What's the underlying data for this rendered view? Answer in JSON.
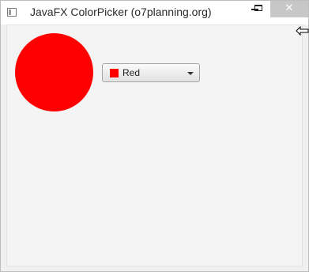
{
  "window": {
    "title": "JavaFX ColorPicker (o7planning.org)",
    "controls": {
      "minimize": "minimize",
      "maximize": "maximize",
      "close": "close"
    }
  },
  "shape": {
    "type": "circle",
    "fill_color": "#ff0000"
  },
  "color_picker": {
    "selected_label": "Red",
    "selected_color": "#ff0000"
  },
  "icons": {
    "app": "app-window-icon",
    "dropdown": "chevron-down-icon",
    "cursor": "resize-cursor-icon"
  },
  "colors": {
    "titlebar": "#ffffff",
    "content_background": "#f4f4f4",
    "close_button": "#c7c7c7"
  }
}
